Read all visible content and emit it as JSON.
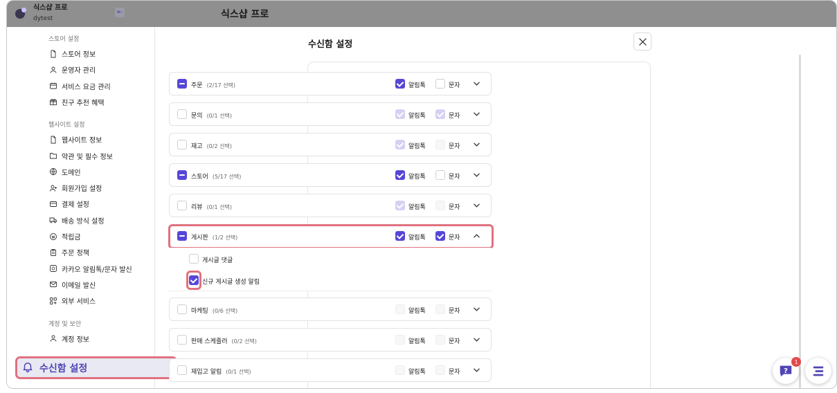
{
  "brand": {
    "title": "식스샵 프로",
    "subtitle": "dytest"
  },
  "app_title": "식스샵 프로",
  "sidebar": {
    "sections": [
      {
        "label": "스토어 설정",
        "items": [
          {
            "label": "스토어 정보",
            "icon": "document-icon"
          },
          {
            "label": "운영자 관리",
            "icon": "users-icon"
          },
          {
            "label": "서비스 요금 관리",
            "icon": "billing-icon"
          },
          {
            "label": "친구 추천 혜택",
            "icon": "gift-icon"
          }
        ]
      },
      {
        "label": "웹사이트 설정",
        "items": [
          {
            "label": "웹사이트 정보",
            "icon": "document-icon"
          },
          {
            "label": "약관 및 필수 정보",
            "icon": "folder-icon"
          },
          {
            "label": "도메인",
            "icon": "globe-icon"
          },
          {
            "label": "회원가입 설정",
            "icon": "user-add-icon"
          },
          {
            "label": "결제 설정",
            "icon": "card-icon"
          },
          {
            "label": "배송 방식 설정",
            "icon": "truck-icon"
          },
          {
            "label": "적립금",
            "icon": "coin-icon"
          },
          {
            "label": "주문 정책",
            "icon": "clipboard-icon"
          },
          {
            "label": "카카오 알림톡/문자 발신",
            "icon": "chat-icon"
          },
          {
            "label": "이메일 발신",
            "icon": "mail-icon"
          },
          {
            "label": "외부 서비스",
            "icon": "grid-icon"
          }
        ]
      },
      {
        "label": "계정 및 보안",
        "items": [
          {
            "label": "계정 정보",
            "icon": "user-icon"
          }
        ]
      }
    ],
    "highlighted_item": {
      "label": "수신함 설정",
      "icon": "bell-icon"
    }
  },
  "main": {
    "title": "수신함 설정",
    "alimtalk_label": "알림톡",
    "sms_label": "문자",
    "categories": [
      {
        "name": "주문",
        "count": "(2/17 선택)",
        "select": "minus",
        "alimtalk": "on",
        "sms": "off",
        "expanded": false
      },
      {
        "name": "문의",
        "count": "(0/1 선택)",
        "select": "off",
        "alimtalk": "faded",
        "sms": "faded",
        "expanded": false
      },
      {
        "name": "재고",
        "count": "(0/2 선택)",
        "select": "off",
        "alimtalk": "faded",
        "sms": "light",
        "expanded": false
      },
      {
        "name": "스토어",
        "count": "(5/17 선택)",
        "select": "minus",
        "alimtalk": "on",
        "sms": "off",
        "expanded": false
      },
      {
        "name": "리뷰",
        "count": "(0/1 선택)",
        "select": "off",
        "alimtalk": "faded",
        "sms": "light",
        "expanded": false
      },
      {
        "name": "게시판",
        "count": "(1/2 선택)",
        "select": "minus",
        "alimtalk": "on",
        "sms": "on",
        "expanded": true,
        "children": [
          {
            "name": "게시글 댓글",
            "checked": false
          },
          {
            "name": "신규 게시글 생성 알림",
            "checked": true
          }
        ]
      },
      {
        "name": "마케팅",
        "count": "(0/6 선택)",
        "select": "off",
        "alimtalk": "light",
        "sms": "light",
        "expanded": false
      },
      {
        "name": "판매 스케줄러",
        "count": "(0/2 선택)",
        "select": "off",
        "alimtalk": "light",
        "sms": "light",
        "expanded": false
      },
      {
        "name": "재입고 알림",
        "count": "(0/1 선택)",
        "select": "off",
        "alimtalk": "light",
        "sms": "light",
        "expanded": false
      }
    ]
  },
  "help": {
    "badge": "1"
  },
  "colors": {
    "accent": "#5646d8",
    "highlight": "#e0717f"
  }
}
